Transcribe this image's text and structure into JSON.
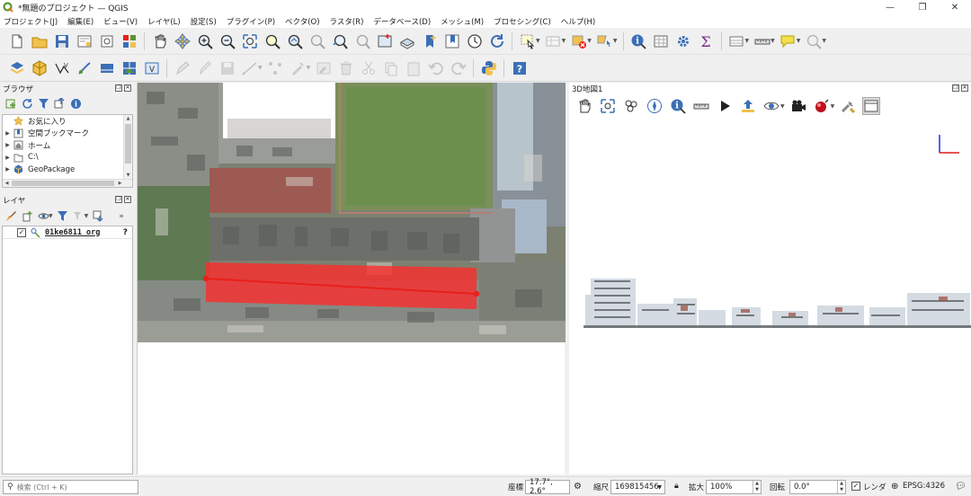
{
  "window": {
    "title": "*無題のプロジェクト — QGIS",
    "minimize": "—",
    "maximize": "❐",
    "close": "✕"
  },
  "menu": [
    "プロジェクト(J)",
    "編集(E)",
    "ビュー(V)",
    "レイヤ(L)",
    "設定(S)",
    "プラグイン(P)",
    "ベクタ(O)",
    "ラスタ(R)",
    "データベース(D)",
    "メッシュ(M)",
    "プロセシング(C)",
    "ヘルプ(H)"
  ],
  "browser": {
    "title": "ブラウザ",
    "items": [
      {
        "label": "お気に入り",
        "icon": "star-icon",
        "expandable": false
      },
      {
        "label": "空間ブックマーク",
        "icon": "bookmark-icon",
        "expandable": true
      },
      {
        "label": "ホーム",
        "icon": "home-folder-icon",
        "expandable": true
      },
      {
        "label": "C:\\",
        "icon": "folder-icon",
        "expandable": true
      },
      {
        "label": "GeoPackage",
        "icon": "geopackage-icon",
        "expandable": true
      }
    ]
  },
  "layers": {
    "title": "レイヤ",
    "items": [
      {
        "label": "01ke6811_org",
        "checked": true,
        "help": "?"
      }
    ]
  },
  "view3d": {
    "title": "3D地図1"
  },
  "statusbar": {
    "search_placeholder": "検索 (Ctrl + K)",
    "coord_label": "座標",
    "coord_value": "17.7°, 2.6°",
    "scale_label": "縮尺",
    "scale_value": "169815456",
    "magnify_label": "拡大",
    "magnify_value": "100%",
    "rotation_label": "回転",
    "rotation_value": "0.0°",
    "render_label": "レンダ",
    "crs_label": "EPSG:4326"
  },
  "colors": {
    "accent_red": "#e8201c",
    "selection_fill": "#ff2a2a",
    "qgis_green": "#589632"
  }
}
